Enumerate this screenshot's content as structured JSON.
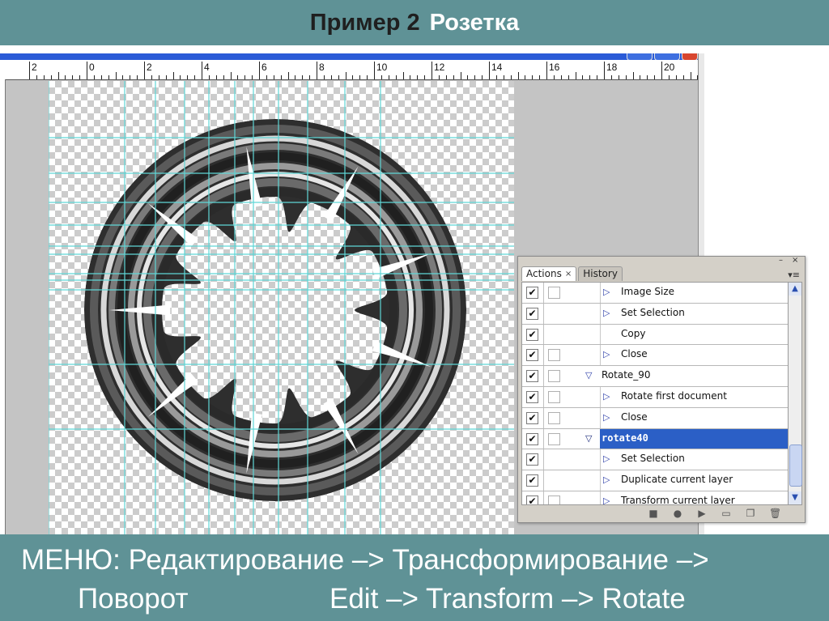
{
  "slide": {
    "title_part1": "Пример 2",
    "title_part2": "Розетка",
    "caption_line1": "МЕНЮ: Редактирование –> Трансформирование –>",
    "caption_line2_ru": "Поворот",
    "caption_line2_en": "Edit –> Transform –> Rotate"
  },
  "ruler": {
    "labels": [
      "2",
      "0",
      "2",
      "4",
      "6",
      "8",
      "10",
      "12",
      "14",
      "16",
      "18",
      "20"
    ]
  },
  "panel": {
    "tabs": [
      {
        "label": "Actions",
        "close": "×",
        "active": true
      },
      {
        "label": "History",
        "active": false
      }
    ],
    "controls": {
      "minimize": "–",
      "close": "×",
      "menu": "≡"
    },
    "rows": [
      {
        "check": "✔",
        "dialog": true,
        "indent": 2,
        "label": "Image Size",
        "selected": false
      },
      {
        "check": "✔",
        "dialog": false,
        "indent": 2,
        "label": "Set Selection",
        "selected": false
      },
      {
        "check": "✔",
        "dialog": false,
        "indent": 2,
        "label": "Copy",
        "selected": false,
        "noarrow": true
      },
      {
        "check": "✔",
        "dialog": true,
        "indent": 2,
        "label": "Close",
        "selected": false
      },
      {
        "check": "✔",
        "dialog": true,
        "indent": 1,
        "label": "Rotate_90",
        "selected": false
      },
      {
        "check": "✔",
        "dialog": true,
        "indent": 2,
        "label": "Rotate first document",
        "selected": false
      },
      {
        "check": "✔",
        "dialog": true,
        "indent": 2,
        "label": "Close",
        "selected": false
      },
      {
        "check": "✔",
        "dialog": true,
        "indent": 1,
        "label": "rotate40",
        "selected": true
      },
      {
        "check": "✔",
        "dialog": false,
        "indent": 2,
        "label": "Set Selection",
        "selected": false
      },
      {
        "check": "✔",
        "dialog": false,
        "indent": 2,
        "label": "Duplicate current layer",
        "selected": false
      },
      {
        "check": "✔",
        "dialog": true,
        "indent": 2,
        "label": "Transform current layer",
        "selected": false
      }
    ],
    "bottom_buttons": [
      "stop-icon",
      "record-icon",
      "play-icon",
      "new-set-icon",
      "new-action-icon",
      "delete-icon"
    ],
    "colors": {
      "selection": "#2b5fc6",
      "arrow": "#2c3ea8"
    }
  },
  "theme": {
    "slide_bar": "#5f9296",
    "guide_color": "#5fd6d6"
  }
}
